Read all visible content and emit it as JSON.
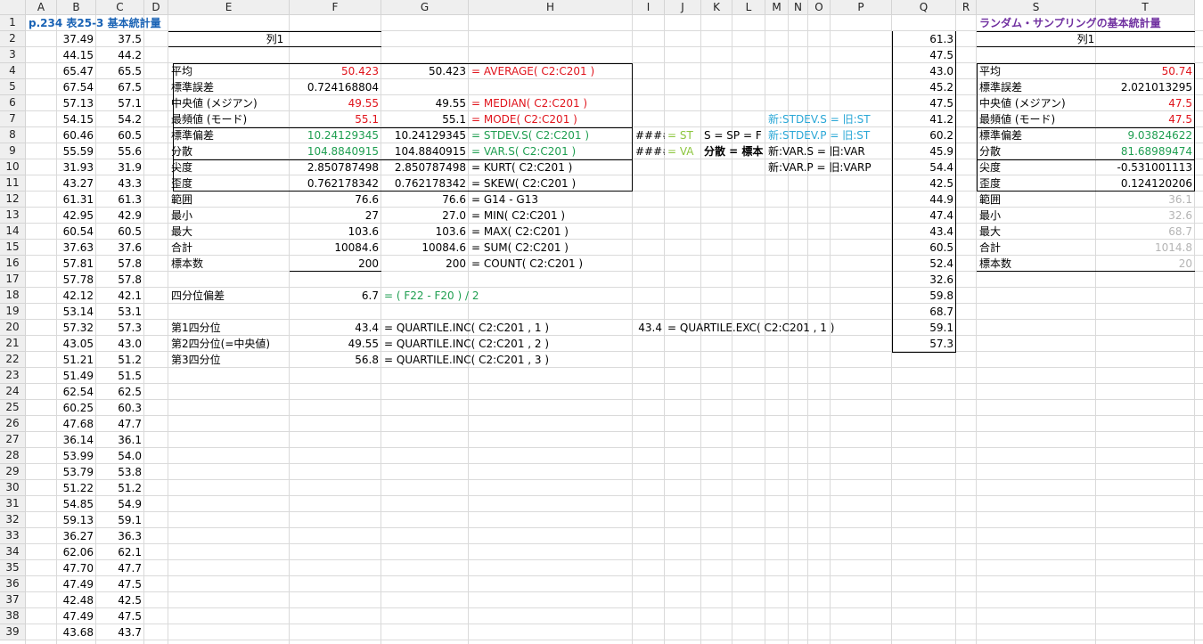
{
  "colors": {
    "red": "#e0141c",
    "green": "#1e9e50",
    "lightgreen": "#8cc63e",
    "cyan": "#2aa7d6",
    "blue": "#1a63b5",
    "purple": "#7030a0",
    "gray": "#b4b4b4"
  },
  "columns": [
    "A",
    "B",
    "C",
    "D",
    "E",
    "F",
    "G",
    "H",
    "I",
    "J",
    "K",
    "L",
    "M",
    "N",
    "O",
    "P",
    "Q",
    "R",
    "S",
    "T"
  ],
  "rows": [
    "1",
    "2",
    "3",
    "4",
    "5",
    "6",
    "7",
    "8",
    "9",
    "10",
    "11",
    "12",
    "13",
    "14",
    "15",
    "16",
    "17",
    "18",
    "19",
    "20",
    "21",
    "22",
    "23",
    "24",
    "25",
    "26",
    "27",
    "28",
    "29",
    "30",
    "31",
    "32",
    "33",
    "34",
    "35",
    "36",
    "37",
    "38",
    "39"
  ],
  "title_a": "p.234  表25-3  基本統計量",
  "title_s": "ランダム・サンプリングの基本統計量",
  "col_b": [
    "37.49",
    "44.15",
    "65.47",
    "67.54",
    "57.13",
    "54.15",
    "60.46",
    "55.59",
    "31.93",
    "43.27",
    "61.31",
    "42.95",
    "60.54",
    "37.63",
    "57.81",
    "57.78",
    "42.12",
    "53.14",
    "57.32",
    "43.05",
    "51.21",
    "51.49",
    "62.54",
    "60.25",
    "47.68",
    "36.14",
    "53.99",
    "53.79",
    "51.22",
    "54.85",
    "59.13",
    "36.27",
    "62.06",
    "47.70",
    "47.49",
    "42.48",
    "47.49",
    "43.68"
  ],
  "col_c": [
    "37.5",
    "44.2",
    "65.5",
    "67.5",
    "57.1",
    "54.2",
    "60.5",
    "55.6",
    "31.9",
    "43.3",
    "61.3",
    "42.9",
    "60.5",
    "37.6",
    "57.8",
    "57.8",
    "42.1",
    "53.1",
    "57.3",
    "43.0",
    "51.2",
    "51.5",
    "62.5",
    "60.3",
    "47.7",
    "36.1",
    "54.0",
    "53.8",
    "51.2",
    "54.9",
    "59.1",
    "36.3",
    "62.1",
    "47.7",
    "47.5",
    "42.5",
    "47.5",
    "43.7"
  ],
  "col_q": [
    "61.3",
    "47.5",
    "43.0",
    "45.2",
    "47.5",
    "41.2",
    "60.2",
    "45.9",
    "54.4",
    "42.5",
    "44.9",
    "47.4",
    "43.4",
    "60.5",
    "52.4",
    "32.6",
    "59.8",
    "68.7",
    "59.1",
    "57.3"
  ],
  "stats_header": "列1",
  "stats_labels": [
    "平均",
    "標準誤差",
    "中央値 (メジアン)",
    "最頻値 (モード)",
    "標準偏差",
    "分散",
    "尖度",
    "歪度",
    "範囲",
    "最小",
    "最大",
    "合計",
    "標本数"
  ],
  "stats_values": [
    "50.423",
    "0.724168804",
    "49.55",
    "55.1",
    "10.24129345",
    "104.8840915",
    "2.850787498",
    "0.762178342",
    "76.6",
    "27",
    "103.6",
    "10084.6",
    "200"
  ],
  "calc_values": [
    "50.423",
    "",
    "49.55",
    "55.1",
    "10.24129345",
    "104.8840915",
    "2.850787498",
    "0.762178342",
    "76.6",
    "27.0",
    "103.6",
    "10084.6",
    "200"
  ],
  "formulas": [
    "= AVERAGE( C2:C201 )",
    "",
    "= MEDIAN( C2:C201 )",
    "= MODE( C2:C201 )",
    "= STDEV.S( C2:C201 )",
    "= VAR.S( C2:C201 )",
    "= KURT( C2:C201 )",
    "= SKEW( C2:C201 )",
    "= G14 - G13",
    "= MIN( C2:C201 )",
    "= MAX( C2:C201 )",
    "= SUM( C2:C201 )",
    "= COUNT( C2:C201 )"
  ],
  "iqr_label": "四分位偏差",
  "iqr_value": "6.7",
  "iqr_formula": "= ( F22 - F20 ) / 2",
  "quartile_labels": [
    "第1四分位",
    "第2四分位(=中央値)",
    "第3四分位"
  ],
  "quartile_values": [
    "43.4",
    "49.55",
    "56.8"
  ],
  "quartile_formulas": [
    "= QUARTILE.INC( C2:C201 , 1 )",
    "= QUARTILE.INC( C2:C201 , 2 )",
    "= QUARTILE.INC( C2:C201 , 3 )"
  ],
  "quartile_exc_value": "43.4",
  "quartile_exc_formula": "= QUARTILE.EXC( C2:C201 , 1 )",
  "i8": "####",
  "j8": "= ST",
  "k8": "S = SP = F",
  "i9": "####",
  "j9": "= VA",
  "k9": "分散 = 標本",
  "note_m7": "新:STDEV.S = 旧:ST",
  "note_m8": "新:STDEV.P = 旧:ST",
  "note_m9": "新:VAR.S = 旧:VAR",
  "note_m10": "新:VAR.P = 旧:VARP",
  "rs_header": "列1",
  "rs_labels": [
    "平均",
    "標準誤差",
    "中央値 (メジアン)",
    "最頻値 (モード)",
    "標準偏差",
    "分散",
    "尖度",
    "歪度",
    "範囲",
    "最小",
    "最大",
    "合計",
    "標本数"
  ],
  "rs_values": [
    "50.74",
    "2.021013295",
    "47.5",
    "47.5",
    "9.03824622",
    "81.68989474",
    "-0.531001113",
    "0.124120206",
    "36.1",
    "32.6",
    "68.7",
    "1014.8",
    "20"
  ]
}
